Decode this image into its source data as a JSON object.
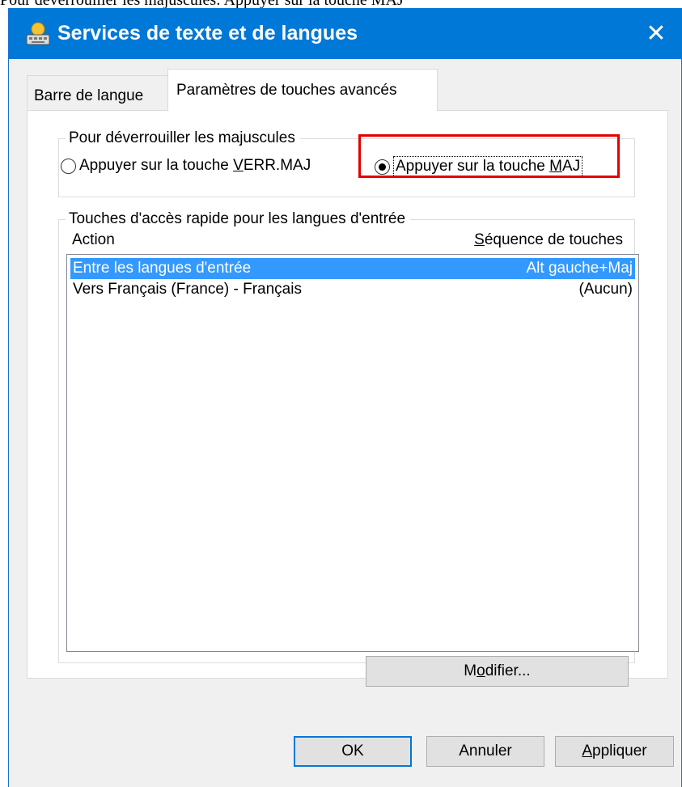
{
  "caption": "Pour déverrouiller les majuscules: Appuyer sur la touche MAJ",
  "window": {
    "title": "Services de texte et de langues",
    "close_label": "✕"
  },
  "tabs": [
    {
      "label": "Barre de langue",
      "active": false
    },
    {
      "label": "Paramètres de touches avancés",
      "active": true
    }
  ],
  "caps_group": {
    "legend": "Pour déverrouiller les majuscules",
    "options": [
      {
        "pre": "Appuyer sur la touche ",
        "mnemonic": "V",
        "post": "ERR.MAJ",
        "selected": false
      },
      {
        "pre": "Appuyer sur la touche ",
        "mnemonic": "M",
        "post": "AJ",
        "selected": true
      }
    ]
  },
  "hotkeys_group": {
    "legend": "Touches d'accès rapide pour les langues d'entrée",
    "columns": {
      "action": "Action",
      "sequence_mnemonic": "S",
      "sequence_rest": "équence de touches"
    },
    "rows": [
      {
        "action": "Entre les langues d'entrée",
        "sequence": "Alt gauche+Maj",
        "selected": true
      },
      {
        "action": "Vers Français (France) - Français",
        "sequence": "(Aucun)",
        "selected": false
      }
    ],
    "modify_button": {
      "pre": "M",
      "mnemonic": "o",
      "post": "difier..."
    }
  },
  "footer": {
    "ok_label": "OK",
    "cancel_label": "Annuler",
    "apply_mnemonic": "A",
    "apply_rest": "ppliquer"
  },
  "colors": {
    "titlebar": "#0078d7",
    "selection": "#3399ff",
    "highlight": "#e60000"
  }
}
